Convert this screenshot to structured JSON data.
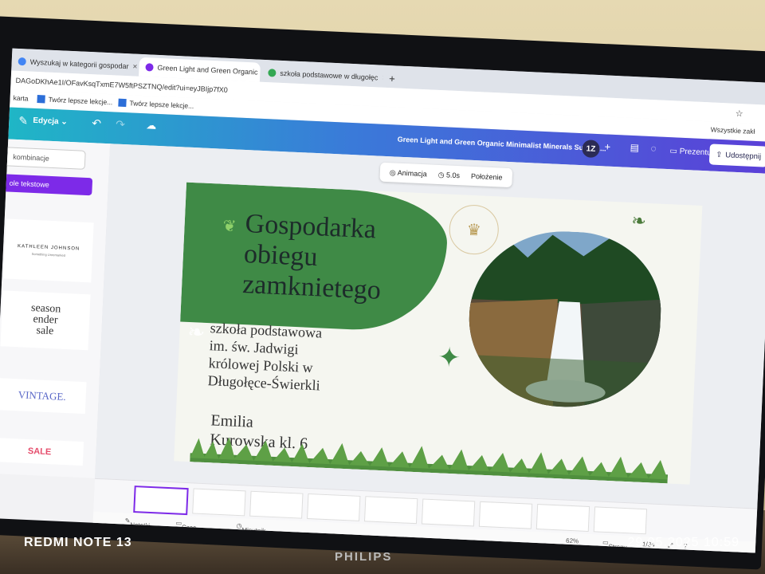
{
  "browser": {
    "tabs": [
      {
        "title": "Wyszukaj w kategorii gospodar",
        "color": "#4285f4"
      },
      {
        "title": "Green Light and Green Organic",
        "color": "#7d2ae8",
        "active": true
      },
      {
        "title": "szkoła podstawowe w długołęc",
        "color": "#34a853"
      }
    ],
    "new_tab": "+",
    "close": "×",
    "url": "DAGoDKhAe1I/OFavKsqTxmE7W5ftPSZTNQ/edit?ui=eyJBIjp7fX0",
    "bookmarks": [
      "karta",
      "Twórz lepsze lekcje...",
      "Twórz lepsze lekcje..."
    ],
    "bookmarks_right": "Wszystkie zakł"
  },
  "canva": {
    "edit_label": "Edycja",
    "doc_title": "Green Light and Green Organic Minimalist Minerals Sustain...",
    "avatar": "1Z",
    "present_label": "Prezentuj",
    "share_label": "Udostępnij",
    "context_toolbar": {
      "animate": "Animacja",
      "duration": "5.0s",
      "position": "Położenie"
    },
    "left_panel": {
      "search_placeholder": "kombinacje",
      "category_button": "ole tekstowe",
      "thumb1_title": "KATHLEEN JOHNSON",
      "thumb1_sub": "Something Unremarked",
      "thumb2_lines": [
        "season",
        "ender",
        "sale"
      ],
      "thumb3": "VINTAGE.",
      "thumb4": "SALE"
    },
    "slide": {
      "title_lines": [
        "Gospodarka",
        "obiegu",
        "zamknietego"
      ],
      "subtitle_lines": [
        "szkoła podstawowa",
        "im. św. Jadwigi",
        "królowej Polski w",
        "Długołęce-Świerkli"
      ],
      "author_lines": [
        "Emilia",
        "Kurowska kl. 6"
      ]
    },
    "bottom": {
      "notes": "Notatki",
      "timer": "Czas trwania",
      "stopwatch": "Minutnik",
      "zoom": "62%",
      "pages_label": "Strony",
      "page_counter": "1/34"
    }
  },
  "device_overlay": {
    "phone_brand": "REDMI NOTE 13",
    "timestamp": "29.05.2025  10:59",
    "monitor_brand": "PHILIPS"
  }
}
